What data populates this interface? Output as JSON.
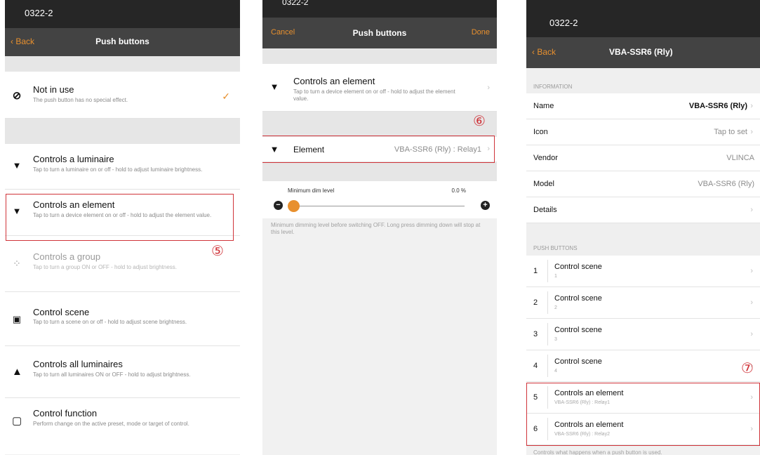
{
  "screen1": {
    "status_title": "0322-2",
    "nav": {
      "back": "Back",
      "title": "Push buttons"
    },
    "options": [
      {
        "icon": "no-entry-icon",
        "title": "Not in use",
        "desc": "The push button has no special effect.",
        "selected": true
      },
      {
        "icon": "luminaire-icon",
        "title": "Controls a luminaire",
        "desc": "Tap to turn a luminaire on or off - hold to adjust luminaire brightness."
      },
      {
        "icon": "luminaire-icon",
        "title": "Controls an element",
        "desc": "Tap to turn a device element on or off - hold to adjust the element value."
      },
      {
        "icon": "group-icon",
        "title": "Controls a group",
        "desc": "Tap to turn a group ON or OFF - hold to adjust brightness."
      },
      {
        "icon": "clapperboard-icon",
        "title": "Control scene",
        "desc": "Tap to turn a scene on or off - hold to adjust scene brightness."
      },
      {
        "icon": "all-luminaires-icon",
        "title": "Controls all luminaires",
        "desc": "Tap to turn all luminaires ON or OFF - hold to adjust brightness."
      },
      {
        "icon": "function-icon",
        "title": "Control function",
        "desc": "Perform change on the active preset, mode or target of control."
      }
    ],
    "check_glyph": "✓",
    "callout": "⑤"
  },
  "screen2": {
    "status_title": "0322-2",
    "nav": {
      "left": "Cancel",
      "title": "Push buttons",
      "right": "Done"
    },
    "option": {
      "title": "Controls an element",
      "desc": "Tap to turn a device element on or off - hold to adjust the element value."
    },
    "element_row": {
      "label": "Element",
      "value": "VBA-SSR6 (Rly) : Relay1"
    },
    "callout": "⑥",
    "dim": {
      "label": "Minimum dim level",
      "value": "0.0 %",
      "level": 0.0,
      "minus": "−",
      "plus": "+"
    },
    "footnote": "Minimum dimming level before switching OFF. Long press dimming down will stop at this level."
  },
  "screen3": {
    "status_title": "0322-2",
    "nav": {
      "back": "Back",
      "title": "VBA-SSR6 (Rly)"
    },
    "info_header": "INFORMATION",
    "info": [
      {
        "label": "Name",
        "value": "VBA-SSR6 (Rly)",
        "emph": true,
        "chevron": true
      },
      {
        "label": "Icon",
        "value": "Tap to set",
        "chevron": true
      },
      {
        "label": "Vendor",
        "value": "VLINCA",
        "chevron": false
      },
      {
        "label": "Model",
        "value": "VBA-SSR6 (Rly)",
        "chevron": false
      },
      {
        "label": "Details",
        "value": "",
        "chevron": true
      }
    ],
    "pb_header": "PUSH BUTTONS",
    "buttons": [
      {
        "num": "1",
        "title": "Control scene",
        "sub": "1"
      },
      {
        "num": "2",
        "title": "Control scene",
        "sub": "2"
      },
      {
        "num": "3",
        "title": "Control scene",
        "sub": "3"
      },
      {
        "num": "4",
        "title": "Control scene",
        "sub": "4"
      },
      {
        "num": "5",
        "title": "Controls an element",
        "sub": "VBA-SSR6 (Rly) : Relay1"
      },
      {
        "num": "6",
        "title": "Controls an element",
        "sub": "VBA-SSR6 (Rly) : Relay2"
      }
    ],
    "footer": "Controls what happens when a push button is used.",
    "callout": "⑦"
  }
}
